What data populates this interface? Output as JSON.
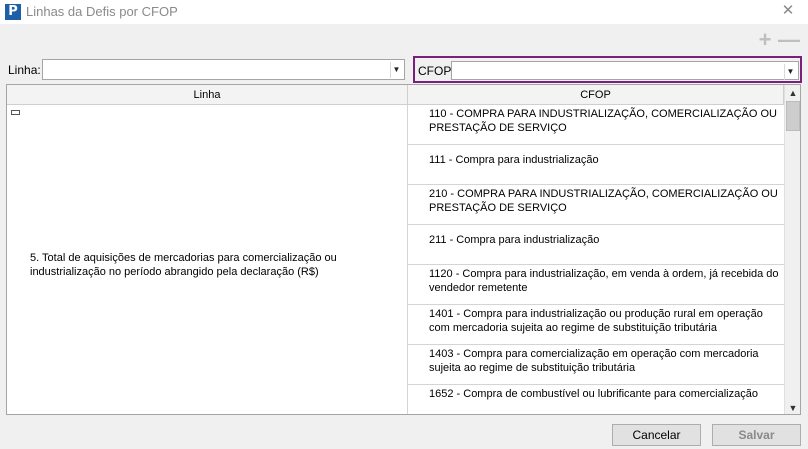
{
  "window": {
    "icon": "P",
    "title": "Linhas da Defis por CFOP",
    "close": "✕"
  },
  "toolbar": {
    "add": "+",
    "remove": "—"
  },
  "filters": {
    "linha_label": "Linha:",
    "linha_value": "",
    "cfop_label": "CFOP:",
    "cfop_value": ""
  },
  "grid": {
    "headers": {
      "linha": "Linha",
      "cfop": "CFOP"
    },
    "linha_text": "5. Total de aquisições de mercadorias para comercialização ou industrialização no período abrangido pela declaração (R$)",
    "cfop_rows": [
      "110 - COMPRA PARA INDUSTRIALIZAÇÃO, COMERCIALIZAÇÃO OU PRESTAÇÃO DE SERVIÇO",
      "111 - Compra para industrialização",
      "210 - COMPRA PARA INDUSTRIALIZAÇÃO, COMERCIALIZAÇÃO OU PRESTAÇÃO DE SERVIÇO",
      "211 - Compra para industrialização",
      "1120 - Compra para industrialização, em venda à ordem, já recebida do vendedor remetente",
      "1401 - Compra para industrialização ou produção rural em operação com mercadoria sujeita ao regime de substituição tributária",
      "1403 - Compra para comercialização em operação com mercadoria sujeita ao regime de substituição tributária",
      "1652 - Compra de combustível ou lubrificante para comercialização"
    ]
  },
  "buttons": {
    "cancel": "Cancelar",
    "save": "Salvar"
  },
  "colors": {
    "cfop_focus_border": "#7a1f7e",
    "app_icon": "#1f5fa8"
  }
}
